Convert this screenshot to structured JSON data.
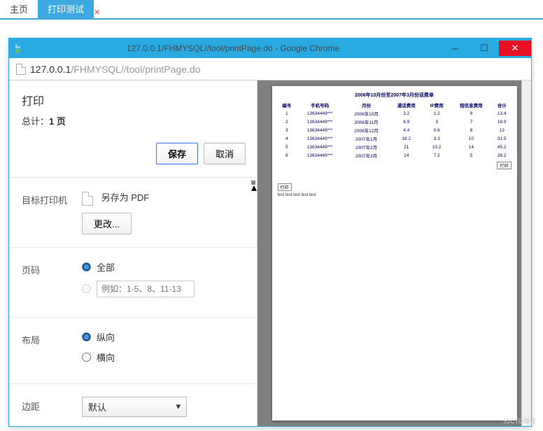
{
  "tabs": {
    "main": "主页",
    "print_test": "打印测试"
  },
  "window": {
    "title": "127.0.0.1/FHMYSQL//tool/printPage.do - Google Chrome",
    "url_prefix": "127.0.0.1",
    "url_rest": "/FHMYSQL//tool/printPage.do"
  },
  "print": {
    "title": "打印",
    "summary_prefix": "总计：",
    "summary_pages": "1 页",
    "save": "保存",
    "cancel": "取消"
  },
  "settings": {
    "dest_label": "目标打印机",
    "dest_value": "另存为 PDF",
    "change": "更改...",
    "pages_label": "页码",
    "pages_all": "全部",
    "pages_placeholder": "例如：1-5、8、11-13",
    "layout_label": "布局",
    "layout_portrait": "纵向",
    "layout_landscape": "横向",
    "margins_label": "边距",
    "margins_value": "默认"
  },
  "chart_data": {
    "type": "table",
    "title": "2006年10月份至2007年3月份话费单",
    "columns": [
      "编号",
      "手机号码",
      "月份",
      "通话费用",
      "IP费用",
      "短信息费用",
      "合计"
    ],
    "rows": [
      [
        "1",
        "13634449***",
        "2006年10月",
        "3.2",
        "1.2",
        "9",
        "13.4"
      ],
      [
        "2",
        "13634449***",
        "2006年11月",
        "6.9",
        "3",
        "7",
        "16.9"
      ],
      [
        "3",
        "13634449***",
        "2006年12月",
        "4.4",
        "0.6",
        "8",
        "13"
      ],
      [
        "4",
        "13634449***",
        "2007年1月",
        "18.2",
        "3.3",
        "10",
        "31.5"
      ],
      [
        "5",
        "13634449***",
        "2007年2月",
        "21",
        "10.2",
        "14",
        "45.2"
      ],
      [
        "6",
        "13634449***",
        "2007年3月",
        "14",
        "7.2",
        "5",
        "26.2"
      ]
    ],
    "print_btn": "打印",
    "footer_text": "test test test test test"
  },
  "watermark": "51CTO博客"
}
